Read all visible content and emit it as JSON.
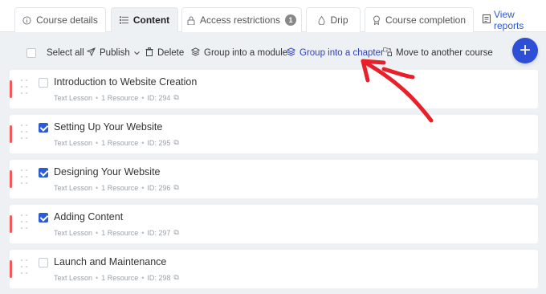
{
  "tabs": [
    {
      "label": "Course details",
      "icon": "info-icon"
    },
    {
      "label": "Content",
      "icon": "list-icon",
      "active": true
    },
    {
      "label": "Access restrictions",
      "icon": "lock-icon",
      "badge": "1"
    },
    {
      "label": "Drip",
      "icon": "drop-icon"
    },
    {
      "label": "Course completion",
      "icon": "award-icon"
    }
  ],
  "view_reports": {
    "label": "View reports",
    "icon": "report-icon"
  },
  "toolbar": {
    "select_all": "Select all",
    "publish": "Publish",
    "delete": "Delete",
    "group_module": "Group into a module",
    "group_chapter": "Group into a chapter",
    "move_course": "Move to another course",
    "add": "+"
  },
  "lessons": [
    {
      "title": "Introduction to Website Creation",
      "type": "Text Lesson",
      "resources": "1 Resource",
      "id": "ID: 294",
      "checked": false
    },
    {
      "title": "Setting Up Your Website",
      "type": "Text Lesson",
      "resources": "1 Resource",
      "id": "ID: 295",
      "checked": true
    },
    {
      "title": "Designing Your Website",
      "type": "Text Lesson",
      "resources": "1 Resource",
      "id": "ID: 296",
      "checked": true
    },
    {
      "title": "Adding Content",
      "type": "Text Lesson",
      "resources": "1 Resource",
      "id": "ID: 297",
      "checked": true
    },
    {
      "title": "Launch and Maintenance",
      "type": "Text Lesson",
      "resources": "1 Resource",
      "id": "ID: 298",
      "checked": false
    }
  ],
  "colors": {
    "accent": "#2d4fd6",
    "marker": "#f25a5a",
    "annotation": "#e8202a"
  }
}
